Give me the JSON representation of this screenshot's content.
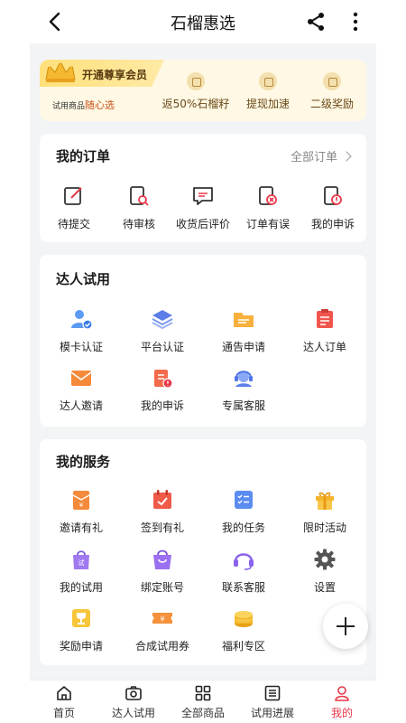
{
  "header": {
    "title": "石榴惠选"
  },
  "vip": {
    "badge": "开通尊享会员",
    "sub_prefix": "试用商品",
    "sub_highlight": "随心选",
    "perks": [
      "返50%石榴籽",
      "提现加速",
      "二级奖励"
    ]
  },
  "orders": {
    "title": "我的订单",
    "link": "全部订单",
    "items": [
      "待提交",
      "待审核",
      "收货后评价",
      "订单有误",
      "我的申诉"
    ]
  },
  "influencer": {
    "title": "达人试用",
    "items": [
      "模卡认证",
      "平台认证",
      "通告申请",
      "达人订单",
      "达人邀请",
      "我的申诉",
      "专属客服"
    ]
  },
  "services": {
    "title": "我的服务",
    "items": [
      "邀请有礼",
      "签到有礼",
      "我的任务",
      "限时活动",
      "我的试用",
      "绑定账号",
      "联系客服",
      "设置",
      "奖励申请",
      "合成试用券",
      "福利专区"
    ]
  },
  "bottom_nav": {
    "tabs": [
      "首页",
      "达人试用",
      "全部商品",
      "试用进展",
      "我的"
    ],
    "active": "我的"
  },
  "colors": {
    "accent": "#e8394a",
    "vip_bg": "#fff8e4",
    "page_bg": "#f3f4f6"
  }
}
